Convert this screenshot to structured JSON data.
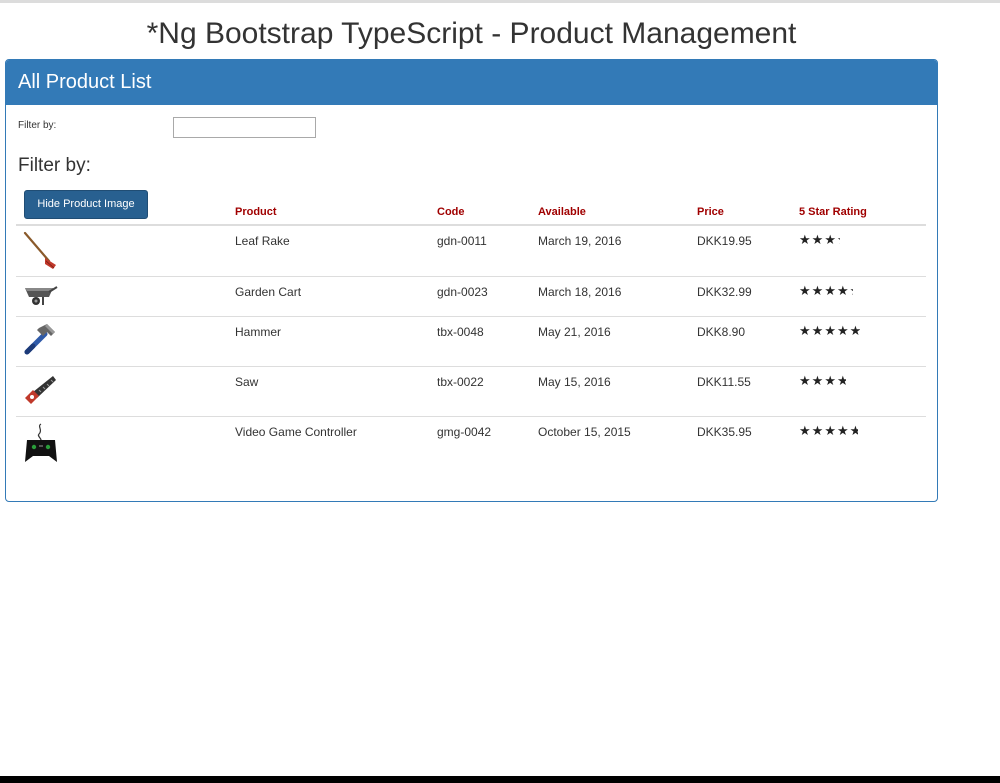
{
  "app": {
    "title": "*Ng Bootstrap TypeScript - Product Management"
  },
  "panel": {
    "heading": "All Product List",
    "filter_label": "Filter by:",
    "filter_value": "",
    "filter_heading": "Filter by:",
    "toggle_image_label": "Hide Product Image"
  },
  "table": {
    "headers": {
      "product": "Product",
      "code": "Code",
      "available": "Available",
      "price": "Price",
      "rating": "5 Star Rating"
    },
    "rows": [
      {
        "image_icon": "leaf-rake-icon",
        "name": "Leaf Rake",
        "code": "gdn-0011",
        "available": "March 19, 2016",
        "price": "DKK19.95",
        "rating": 3.2
      },
      {
        "image_icon": "garden-cart-icon",
        "name": "Garden Cart",
        "code": "gdn-0023",
        "available": "March 18, 2016",
        "price": "DKK32.99",
        "rating": 4.2
      },
      {
        "image_icon": "hammer-icon",
        "name": "Hammer",
        "code": "tbx-0048",
        "available": "May 21, 2016",
        "price": "DKK8.90",
        "rating": 4.8
      },
      {
        "image_icon": "saw-icon",
        "name": "Saw",
        "code": "tbx-0022",
        "available": "May 15, 2016",
        "price": "DKK11.55",
        "rating": 3.7
      },
      {
        "image_icon": "video-game-controller-icon",
        "name": "Video Game Controller",
        "code": "gmg-0042",
        "available": "October 15, 2015",
        "price": "DKK35.95",
        "rating": 4.6
      }
    ]
  },
  "colors": {
    "panel_primary": "#337ab7",
    "button_primary": "#286090",
    "header_text": "#a00000"
  }
}
